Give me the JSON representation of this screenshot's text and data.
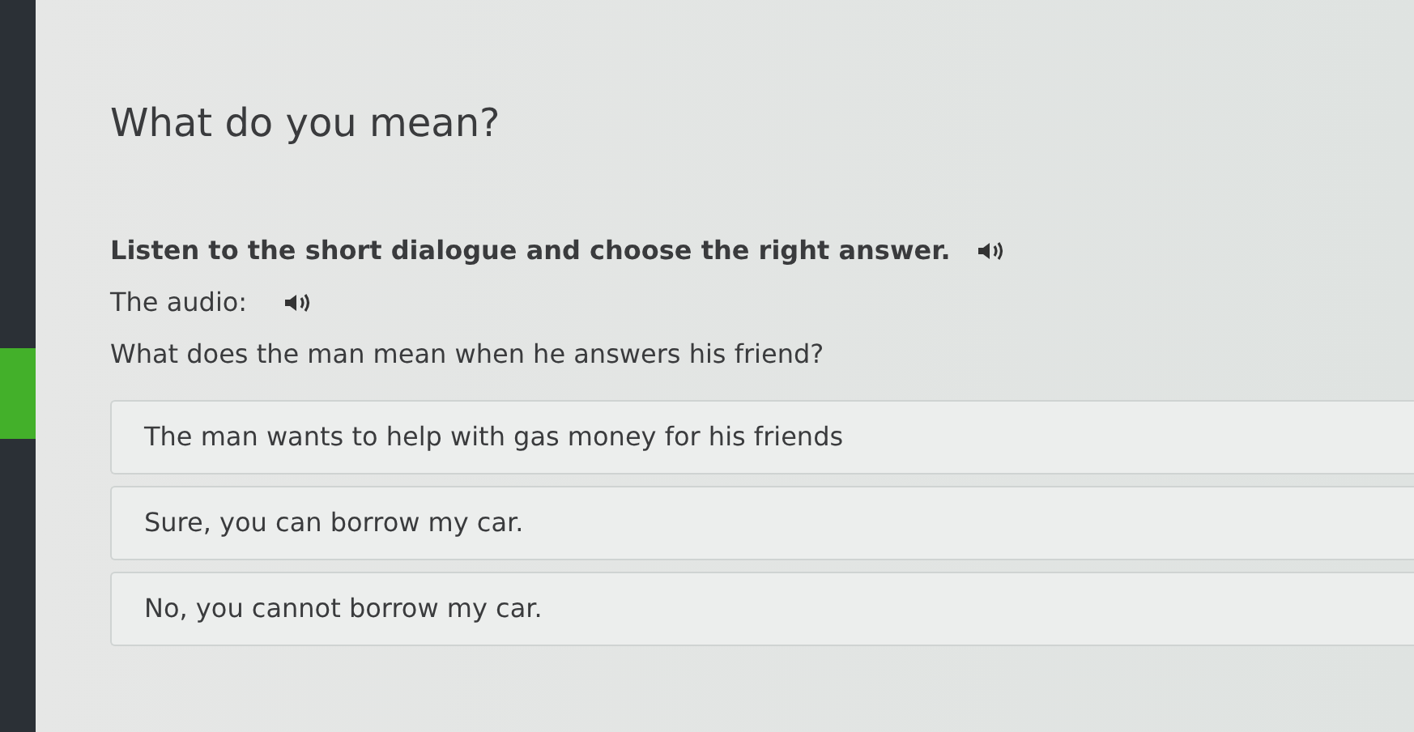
{
  "title": "What do you mean?",
  "instruction": "Listen to the short dialogue and choose the right answer.",
  "audio_label": "The audio:",
  "question": "What does the man mean when he answers his friend?",
  "options": [
    {
      "text": "The man wants to help with gas money for his friends"
    },
    {
      "text": "Sure, you can borrow my car."
    },
    {
      "text": "No, you cannot borrow my car."
    }
  ]
}
